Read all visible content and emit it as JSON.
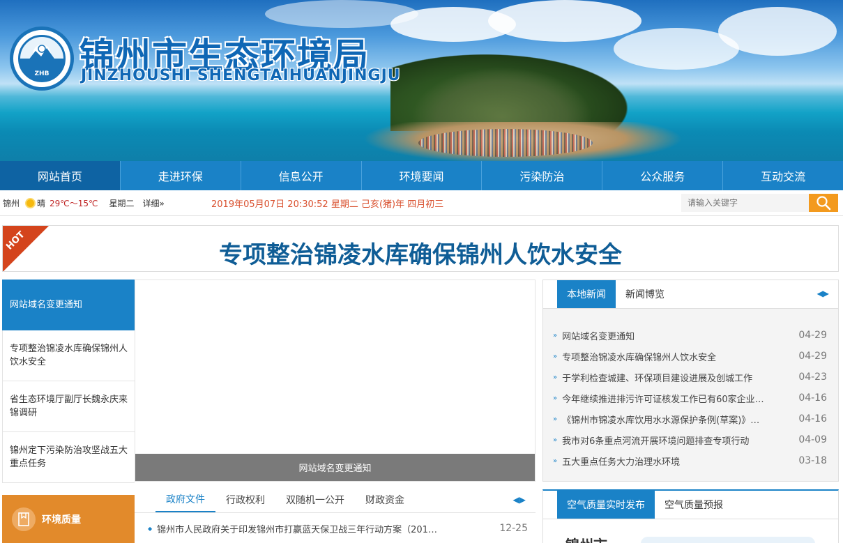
{
  "header": {
    "title": "锦州市生态环境局",
    "subtitle": "JINZHOUSHI SHENGTAIHUANJINGJU",
    "logo_text": "ZHB"
  },
  "nav": {
    "items": [
      {
        "label": "网站首页"
      },
      {
        "label": "走进环保"
      },
      {
        "label": "信息公开"
      },
      {
        "label": "环境要闻"
      },
      {
        "label": "污染防治"
      },
      {
        "label": "公众服务"
      },
      {
        "label": "互动交流"
      }
    ]
  },
  "infobar": {
    "city": "锦州",
    "condition": "晴",
    "temperature": "29℃～15℃",
    "weekday": "星期二",
    "more": "详细»",
    "datetime": "2019年05月07日 20:30:52 星期二  己亥(猪)年 四月初三",
    "search_placeholder": "请输入关键字"
  },
  "hot": {
    "badge": "HOT",
    "headline": "专项整治锦凌水库确保锦州人饮水安全"
  },
  "slider": {
    "items": [
      {
        "label": "网站域名变更通知"
      },
      {
        "label": "专项整治锦凌水库确保锦州人饮水安全"
      },
      {
        "label": "省生态环境厅副厅长魏永庆来锦调研"
      },
      {
        "label": "锦州定下污染防治攻坚战五大重点任务"
      }
    ],
    "caption": "网站域名变更通知"
  },
  "news": {
    "tabs": [
      {
        "label": "本地新闻"
      },
      {
        "label": "新闻博览"
      }
    ],
    "items": [
      {
        "title": "网站域名变更通知",
        "date": "04-29"
      },
      {
        "title": "专项整治锦凌水库确保锦州人饮水安全",
        "date": "04-29"
      },
      {
        "title": "于学利检查城建、环保项目建设进展及创城工作",
        "date": "04-23"
      },
      {
        "title": "今年继续推进排污许可证核发工作已有60家企业…",
        "date": "04-16"
      },
      {
        "title": "《锦州市锦凌水库饮用水水源保护条例(草案)》…",
        "date": "04-16"
      },
      {
        "title": "我市对6条重点河流开展环境问题排查专项行动",
        "date": "04-09"
      },
      {
        "title": "五大重点任务大力治理水环境",
        "date": "03-18"
      }
    ]
  },
  "env_quality": {
    "label": "环境质量"
  },
  "docs": {
    "tabs": [
      {
        "label": "政府文件"
      },
      {
        "label": "行政权利"
      },
      {
        "label": "双随机一公开"
      },
      {
        "label": "财政资金"
      }
    ],
    "items": [
      {
        "title": "锦州市人民政府关于印发锦州市打嬴蓝天保卫战三年行动方案（201…",
        "date": "12-25"
      }
    ]
  },
  "air": {
    "tabs": [
      {
        "label": "空气质量实时发布"
      },
      {
        "label": "空气质量预报"
      }
    ],
    "city": "锦州市"
  },
  "colors": {
    "primary": "#1a82c7",
    "nav_active": "#0e63a3",
    "hot": "#d4441c",
    "headline": "#0f5d96",
    "orange": "#e28a2b",
    "datetime": "#d9502e"
  }
}
